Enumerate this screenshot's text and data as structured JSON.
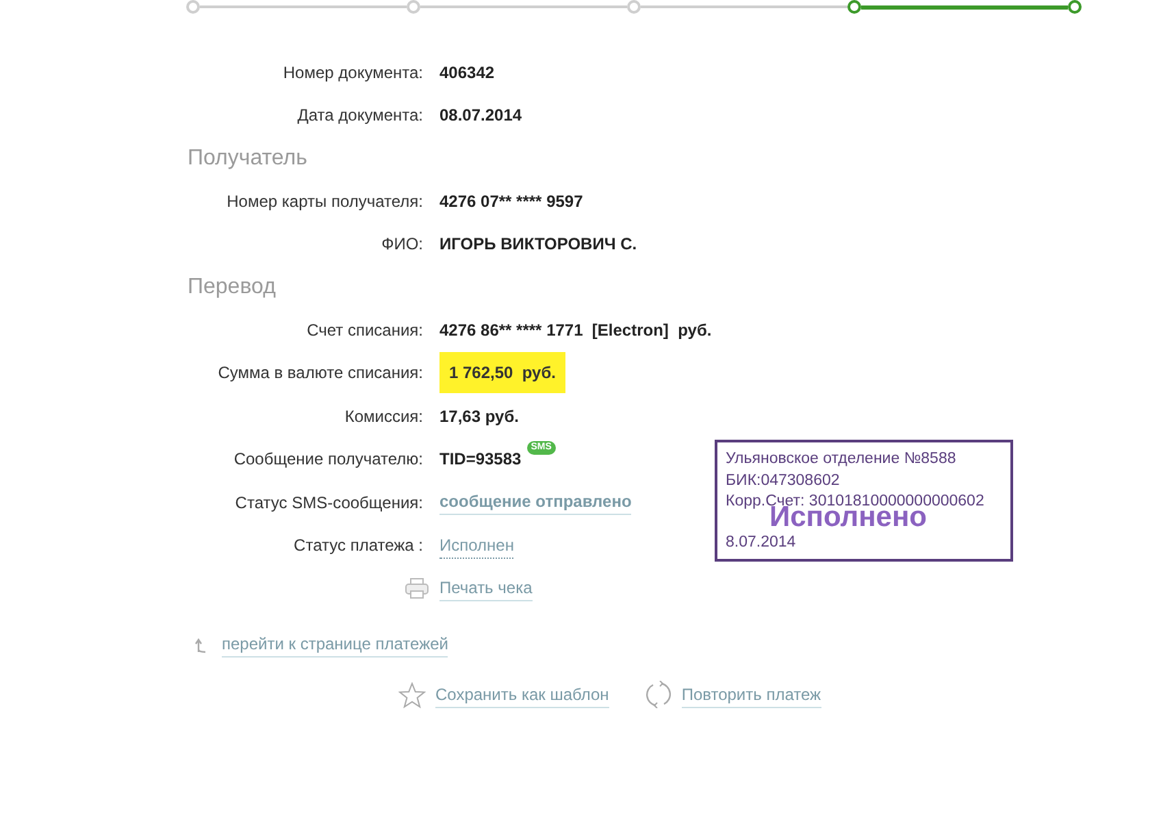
{
  "steps": [
    {
      "done": false
    },
    {
      "done": false
    },
    {
      "done": false
    },
    {
      "done": true
    },
    {
      "done": true
    }
  ],
  "sections": [
    {
      "rows": [
        {
          "kind": "text",
          "label": "Номер документа:",
          "value": "406342"
        },
        {
          "kind": "text",
          "label": "Дата документа:",
          "value": "08.07.2014"
        }
      ]
    },
    {
      "title": "Получатель",
      "rows": [
        {
          "kind": "text",
          "label": "Номер карты получателя:",
          "value": "4276 07** **** 9597"
        },
        {
          "kind": "text",
          "label": "ФИО:",
          "value": "ИГОРЬ ВИКТОРОВИЧ С."
        }
      ]
    },
    {
      "title": "Перевод",
      "rows": [
        {
          "kind": "text",
          "label": "Счет списания:",
          "value": "4276 86** **** 1771  [Electron]  руб."
        },
        {
          "kind": "highlight",
          "label": "Сумма в валюте списания:",
          "value": "1 762,50  руб."
        },
        {
          "kind": "text",
          "label": "Комиссия:",
          "value": "17,63 руб."
        },
        {
          "kind": "sms",
          "label": "Сообщение получателю:",
          "value": "TID=93583",
          "badge": "SMS"
        },
        {
          "kind": "link",
          "label": "Статус SMS-сообщения:",
          "value": "сообщение отправлено"
        },
        {
          "kind": "status",
          "label": "Статус платежа :",
          "value": "Исполнен"
        }
      ]
    }
  ],
  "print_link": "Печать чека",
  "stamp": {
    "lines": [
      "Ульяновское отделение №8588",
      "БИК:047308602",
      "Корр.Счет: 30101810000000000602"
    ],
    "mark": "Исполнено",
    "date": "8.07.2014"
  },
  "back_link": "перейти к странице платежей",
  "actions": [
    {
      "kind": "save",
      "label": "Сохранить как шаблон"
    },
    {
      "kind": "repeat",
      "label": "Повторить платеж"
    }
  ]
}
